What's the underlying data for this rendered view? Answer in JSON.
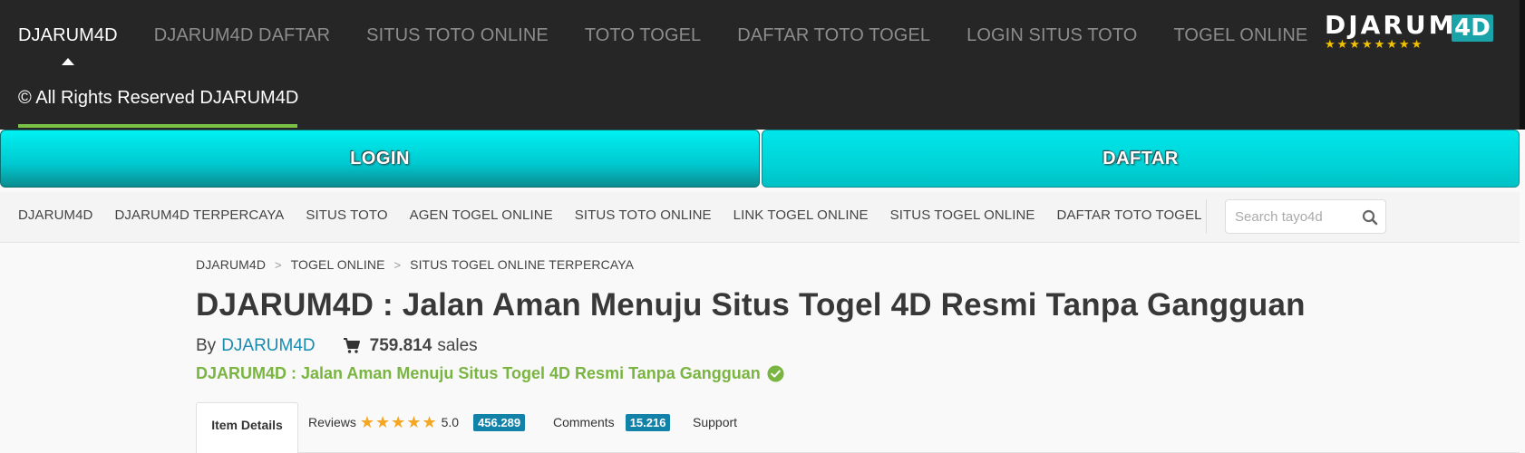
{
  "topnav": {
    "items": [
      {
        "label": "DJARUM4D",
        "active": true
      },
      {
        "label": "DJARUM4D DAFTAR"
      },
      {
        "label": "SITUS TOTO ONLINE"
      },
      {
        "label": "TOTO TOGEL"
      },
      {
        "label": "DAFTAR TOTO TOGEL"
      },
      {
        "label": "LOGIN SITUS TOTO"
      },
      {
        "label": "TOGEL ONLINE"
      }
    ],
    "copyright": "© All Rights Reserved DJARUM4D",
    "logo": {
      "word": "DJARUM",
      "box": "4D",
      "stars": "★★★★★★★★"
    }
  },
  "buttons": {
    "login": "LOGIN",
    "daftar": "DAFTAR"
  },
  "subnav": {
    "items": [
      "DJARUM4D",
      "DJARUM4D TERPERCAYA",
      "SITUS TOTO",
      "AGEN TOGEL ONLINE",
      "SITUS TOTO ONLINE",
      "LINK TOGEL ONLINE",
      "SITUS TOGEL ONLINE",
      "DAFTAR TOTO TOGEL"
    ],
    "search_placeholder": "Search tayo4d"
  },
  "breadcrumb": [
    "DJARUM4D",
    "TOGEL ONLINE",
    "SITUS TOGEL ONLINE TERPERCAYA"
  ],
  "title": "DJARUM4D : Jalan Aman Menuju Situs Togel 4D Resmi Tanpa Gangguan",
  "byline": {
    "by": "By",
    "author": "DJARUM4D",
    "sales_count": "759.814",
    "sales_label": "sales"
  },
  "subtitle": "DJARUM4D : Jalan Aman Menuju Situs Togel 4D Resmi Tanpa Gangguan",
  "tabs": {
    "item_details": "Item Details",
    "reviews_label": "Reviews",
    "stars": "★★★★★",
    "rating": "5.0",
    "reviews_count": "456.289",
    "comments_label": "Comments",
    "comments_count": "15.216",
    "support_label": "Support"
  },
  "colors": {
    "accent_green": "#7bc146",
    "cyan": "#00d4d8",
    "link_blue": "#1a8bb0",
    "badge_blue": "#1382a8",
    "star_yellow": "#f5a623"
  }
}
